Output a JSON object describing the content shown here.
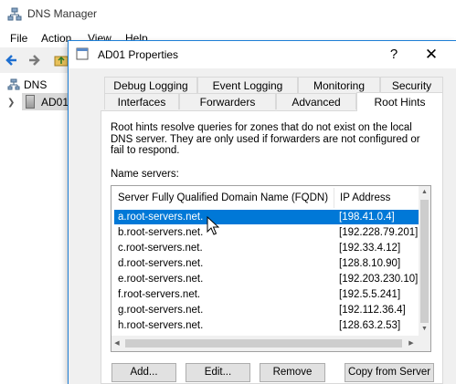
{
  "app": {
    "title": "DNS Manager",
    "icon": "dns-manager-icon",
    "menu": [
      "File",
      "Action",
      "View",
      "Help"
    ]
  },
  "toolbar": {
    "back_icon": "back-arrow-icon",
    "forward_icon": "forward-arrow-icon",
    "folder_icon": "folder-up-icon"
  },
  "tree": {
    "root": "DNS",
    "children": [
      {
        "label": "AD01",
        "selected": true
      }
    ]
  },
  "dialog": {
    "title": "AD01 Properties",
    "help_glyph": "?",
    "close_glyph": "✕",
    "tabs_row1": [
      "Debug Logging",
      "Event Logging",
      "Monitoring",
      "Security"
    ],
    "tabs_row2": [
      "Interfaces",
      "Forwarders",
      "Advanced",
      "Root Hints"
    ],
    "active_tab": "Root Hints",
    "description": "Root hints resolve queries for zones that do not exist on the local DNS server.   They are only used if forwarders are not configured or fail to respond.",
    "name_servers_label": "Name servers:",
    "columns": [
      "Server Fully Qualified Domain Name (FQDN)",
      "IP Address"
    ],
    "rows": [
      {
        "fqdn": "a.root-servers.net.",
        "ip": "[198.41.0.4]",
        "selected": true
      },
      {
        "fqdn": "b.root-servers.net.",
        "ip": "[192.228.79.201]",
        "selected": false
      },
      {
        "fqdn": "c.root-servers.net.",
        "ip": "[192.33.4.12]",
        "selected": false
      },
      {
        "fqdn": "d.root-servers.net.",
        "ip": "[128.8.10.90]",
        "selected": false
      },
      {
        "fqdn": "e.root-servers.net.",
        "ip": "[192.203.230.10]",
        "selected": false
      },
      {
        "fqdn": "f.root-servers.net.",
        "ip": "[192.5.5.241]",
        "selected": false
      },
      {
        "fqdn": "g.root-servers.net.",
        "ip": "[192.112.36.4]",
        "selected": false
      },
      {
        "fqdn": "h.root-servers.net.",
        "ip": "[128.63.2.53]",
        "selected": false
      }
    ],
    "buttons": {
      "add": "Add...",
      "edit": "Edit...",
      "remove": "Remove",
      "copy_from_server": "Copy from Server"
    }
  },
  "colors": {
    "selection": "#0078d7",
    "dialog_border": "#1e7fd6",
    "dialog_bg": "#f0f0f0"
  }
}
